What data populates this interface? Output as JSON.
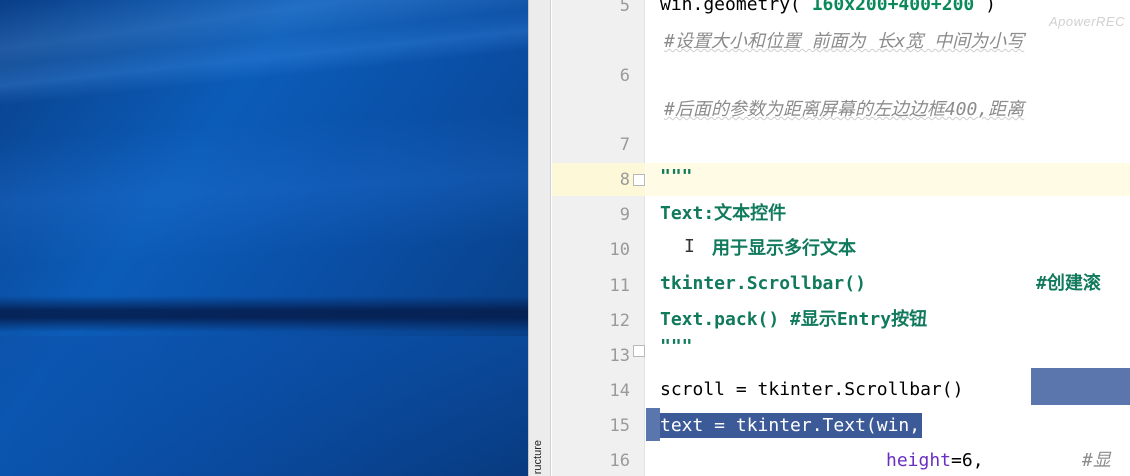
{
  "ide": {
    "side_panel_label": "ructure",
    "watermark": "ApowerREC",
    "line_numbers": [
      "5",
      "6",
      "7",
      "8",
      "9",
      "10",
      "11",
      "12",
      "13",
      "14",
      "15",
      "16"
    ],
    "lines": {
      "l5_prefix": "win.geometry( ",
      "l5_string": "160x200+400+200",
      "l5_suffix": " )",
      "l6a_comment": "#设置大小和位置 前面为 长x宽 中间为小写",
      "l6b_comment": "#后面的参数为距离屏幕的左边边框400,距离",
      "l8_docstring_open": "\"\"\"",
      "l9_text": "Text:文本控件",
      "l10_text": "用于显示多行文本",
      "l11_code": "tkinter.Scrollbar()",
      "l11_comment": "#创建滚",
      "l12_text": "Text.pack() #显示Entry按钮",
      "l13_docstring_close": "\"\"\"",
      "l14_code": "scroll = tkinter.Scrollbar()",
      "l15_selected": "text = tkinter.Text(win,",
      "l16_param": "height",
      "l16_value": "=6,",
      "l16_comment": "#显"
    },
    "colors": {
      "selection": "#3d5a98",
      "current_line": "#fffbe5",
      "docstring": "#117a5c"
    }
  }
}
